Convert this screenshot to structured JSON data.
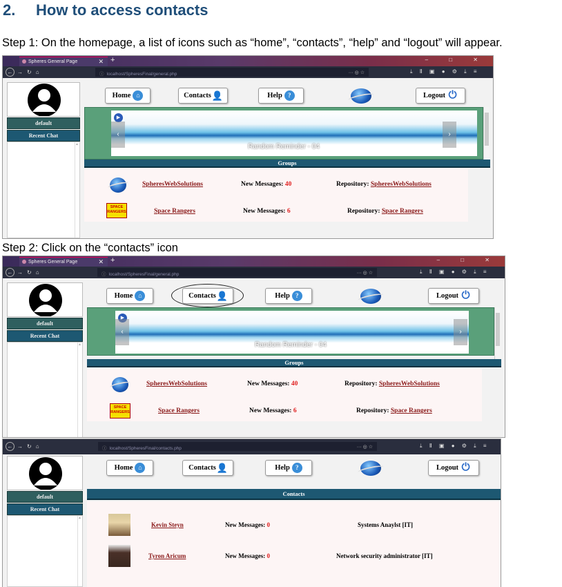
{
  "heading": {
    "number": "2.",
    "title": "How to access contacts"
  },
  "step1": "Step 1: On the homepage, a list of icons such as “home”, “contacts”, “help” and “logout” will appear.",
  "step2": "Step 2: Click on the “contacts” icon",
  "browser": {
    "tab_title": "Spheres General Page",
    "url_general": "localhost/SpheresFinal/general.php",
    "url_contacts": "localhost/SpheresFinal/contacts.php",
    "url_actions": "··· ◎ ☆",
    "toolbar_right": "⤓ Ⅱ ▣ ● ⚙ ⤓ ≡",
    "window_controls": "– □ ✕"
  },
  "sidebar": {
    "user": "default",
    "recent_chat": "Recent Chat"
  },
  "nav": {
    "home": "Home",
    "contacts": "Contacts",
    "help": "Help",
    "logout": "Logout"
  },
  "slider": {
    "caption": "Random Reminder - 04"
  },
  "groups": {
    "header": "Groups",
    "rows": [
      {
        "name": "SpheresWebSolutions",
        "new_label": "New Messages:",
        "new_count": "40",
        "repo_label": "Repository:",
        "repo_name": "SpheresWebSolutions"
      },
      {
        "name": "Space Rangers",
        "new_label": "New Messages:",
        "new_count": "6",
        "repo_label": "Repository:",
        "repo_name": "Space Rangers",
        "logo_text": "SPACE RANGERS"
      }
    ]
  },
  "contacts": {
    "header": "Contacts",
    "rows": [
      {
        "name": "Kevin Steyn",
        "new_label": "New Messages:",
        "new_count": "0",
        "role": "Systems Anaylst [IT]"
      },
      {
        "name": "Tyron Aricum",
        "new_label": "New Messages:",
        "new_count": "0",
        "role": "Network security administrator [IT]"
      }
    ]
  }
}
